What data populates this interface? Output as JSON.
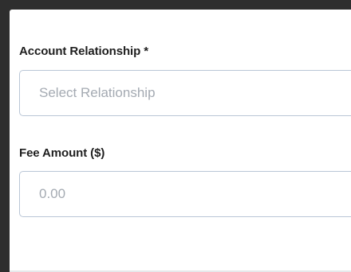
{
  "form": {
    "relationship": {
      "label": "Account Relationship *",
      "placeholder": "Select Relationship",
      "value": ""
    },
    "fee": {
      "label": "Fee Amount ($)",
      "placeholder": "0.00",
      "value": ""
    }
  },
  "colors": {
    "backdrop": "#2e2e2e",
    "panel": "#ffffff",
    "input_border": "#b9c6d6",
    "placeholder": "#a4aab2",
    "label": "#1f1f1f"
  }
}
